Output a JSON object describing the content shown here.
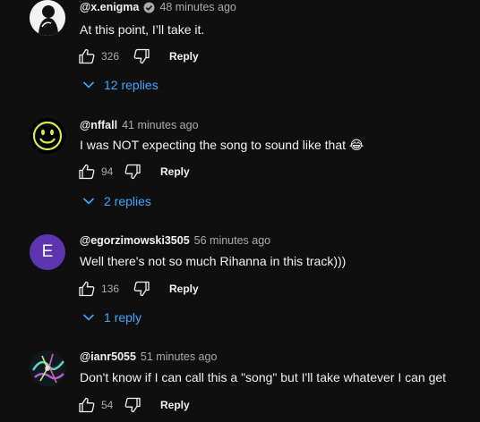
{
  "comments": [
    {
      "author": "@x.enigma",
      "verified": true,
      "time": "48 minutes ago",
      "text": "At this point, I’ll take it.",
      "likes": "326",
      "reply_label": "Reply",
      "replies_label": "12 replies",
      "avatar": "silhouette-avatar"
    },
    {
      "author": "@nffall",
      "verified": false,
      "time": "41 minutes ago",
      "text": "I was NOT expecting the song to sound like that 😂",
      "likes": "94",
      "reply_label": "Reply",
      "replies_label": "2 replies",
      "avatar": "smiley-avatar"
    },
    {
      "author": "@egorzimowski3505",
      "verified": false,
      "time": "56 minutes ago",
      "text": "Well there's not so much Rihanna in this track)))",
      "likes": "136",
      "reply_label": "Reply",
      "replies_label": "1 reply",
      "avatar_letter": "E",
      "avatar_color": "#5e35b1"
    },
    {
      "author": "@ianr5055",
      "verified": false,
      "time": "51 minutes ago",
      "text": "Don't know if I can call this a \"song\" but I'll take whatever I can get",
      "likes": "54",
      "reply_label": "Reply",
      "avatar": "abstract-avatar"
    }
  ],
  "colors": {
    "background": "#0f0f0f",
    "text": "#f1f1f1",
    "secondary": "#aaaaaa",
    "link": "#3ea6ff"
  }
}
